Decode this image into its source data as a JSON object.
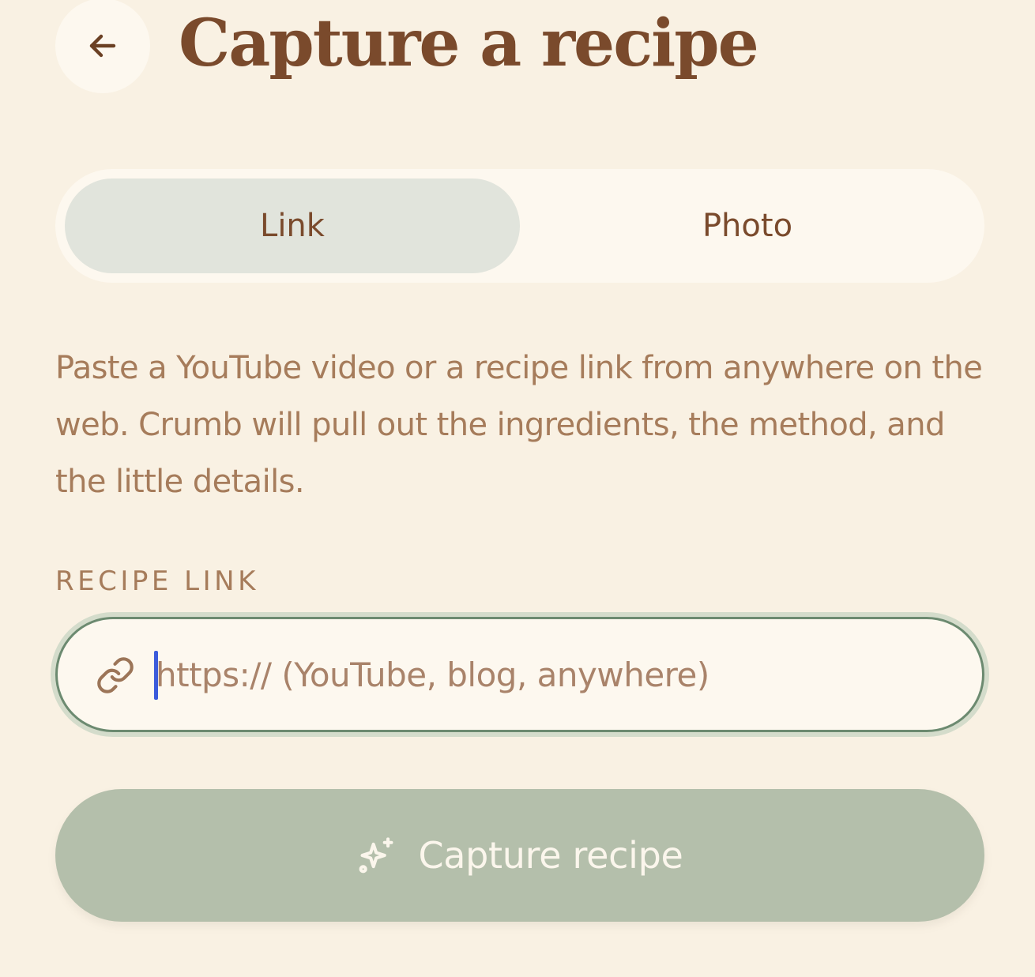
{
  "header": {
    "title": "Capture a recipe",
    "back_icon": "arrow-left-icon"
  },
  "mode_tabs": [
    {
      "label": "Link",
      "selected": true
    },
    {
      "label": "Photo",
      "selected": false
    }
  ],
  "description": "Paste a YouTube video or a recipe link from anywhere on the web. Crumb will pull out the ingredients, the method, and the little details.",
  "recipe_link": {
    "label": "RECIPE LINK",
    "value": "",
    "placeholder": "https:// (YouTube, blog, anywhere)",
    "icon": "link-icon"
  },
  "submit": {
    "label": "Capture recipe",
    "icon": "sparkle-icon"
  },
  "colors": {
    "background": "#f9f1e3",
    "title": "#7a4a2c",
    "body_text": "#a67c5b",
    "selected_tab": "#e1e4dc",
    "input_border": "#6c8a70",
    "button": "#b4bfab"
  }
}
